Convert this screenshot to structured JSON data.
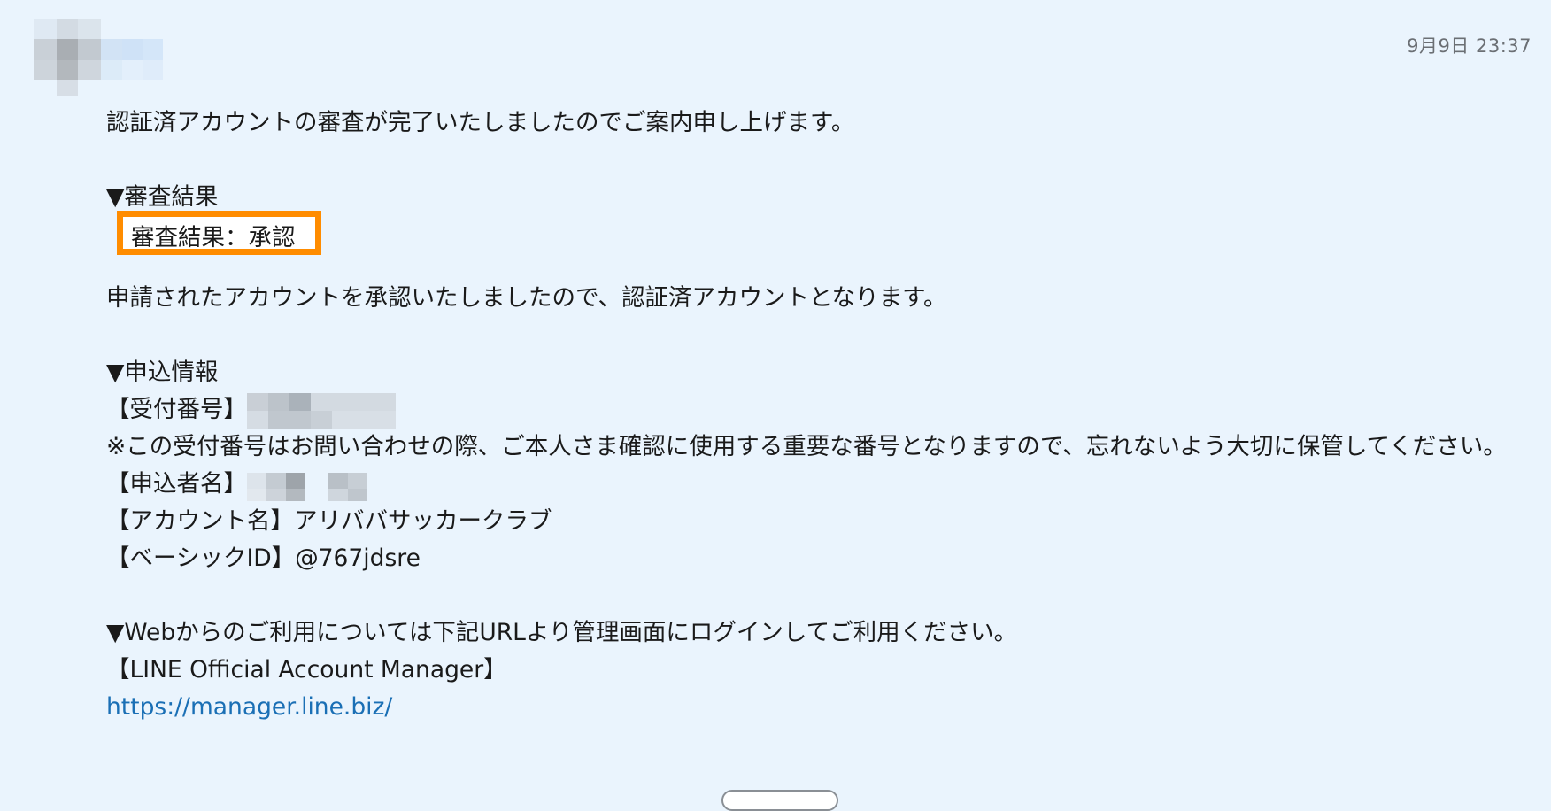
{
  "header": {
    "timestamp": "9月9日 23:37"
  },
  "message": {
    "intro": "認証済アカウントの審査が完了いたしましたのでご案内申し上げます。",
    "review_heading": "▼審査結果",
    "review_result": "審査結果：承認",
    "approval_note": "申請されたアカウントを承認いたしましたので、認証済アカウントとなります。",
    "application_heading": "▼申込情報",
    "receipt_number_label": "【受付番号】",
    "receipt_note": "※この受付番号はお問い合わせの際、ご本人さま確認に使用する重要な番号となりますので、忘れないよう大切に保管してください。",
    "applicant_name_label": "【申込者名】",
    "account_name_line": "【アカウント名】アリババサッカークラブ",
    "basic_id_line": "【ベーシックID】@767jdsre",
    "web_heading": "▼Webからのご利用については下記URLより管理画面にログインしてご利用ください。",
    "manager_label": "【LINE Official Account Manager】",
    "manager_url": "https://manager.line.biz/"
  },
  "colors": {
    "background": "#eaf4fd",
    "highlight_border": "#ff8c00",
    "link": "#1a6fb5",
    "timestamp": "#6b6f74"
  }
}
